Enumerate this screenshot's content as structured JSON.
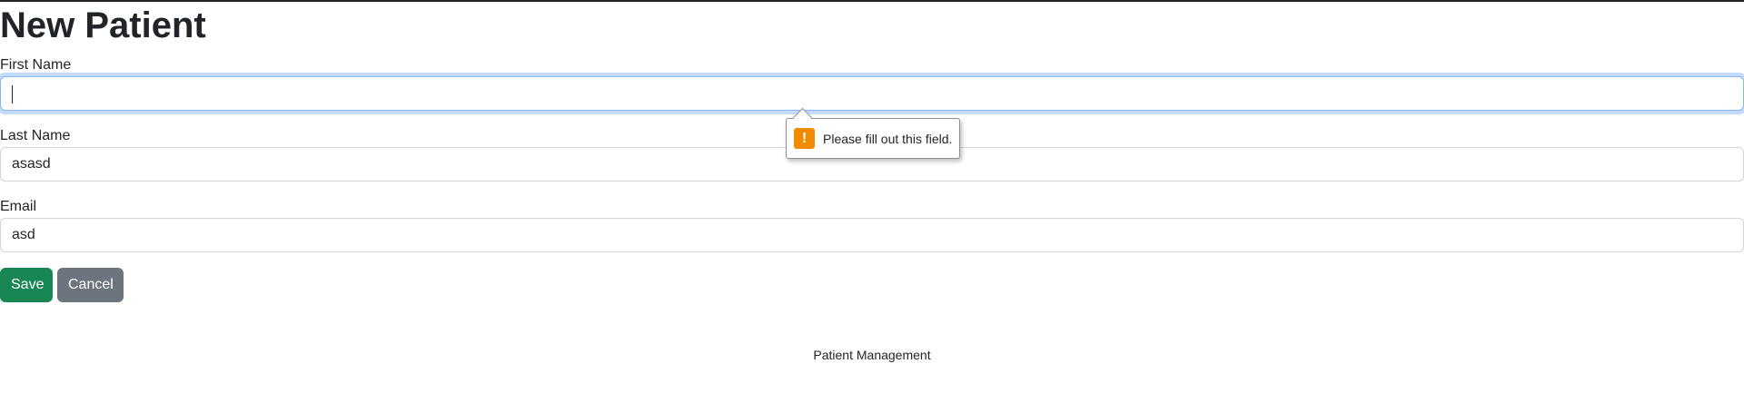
{
  "page": {
    "title": "New Patient"
  },
  "form": {
    "first_name": {
      "label": "First Name",
      "value": ""
    },
    "last_name": {
      "label": "Last Name",
      "value": "asasd"
    },
    "email": {
      "label": "Email",
      "value": "asd"
    }
  },
  "validation": {
    "message": "Please fill out this field.",
    "icon": "warning-icon",
    "icon_glyph": "!",
    "icon_color": "#f38b00"
  },
  "actions": {
    "save_label": "Save",
    "cancel_label": "Cancel",
    "save_color": "#198754",
    "cancel_color": "#6c757d"
  },
  "footer": {
    "text": "Patient Management"
  }
}
